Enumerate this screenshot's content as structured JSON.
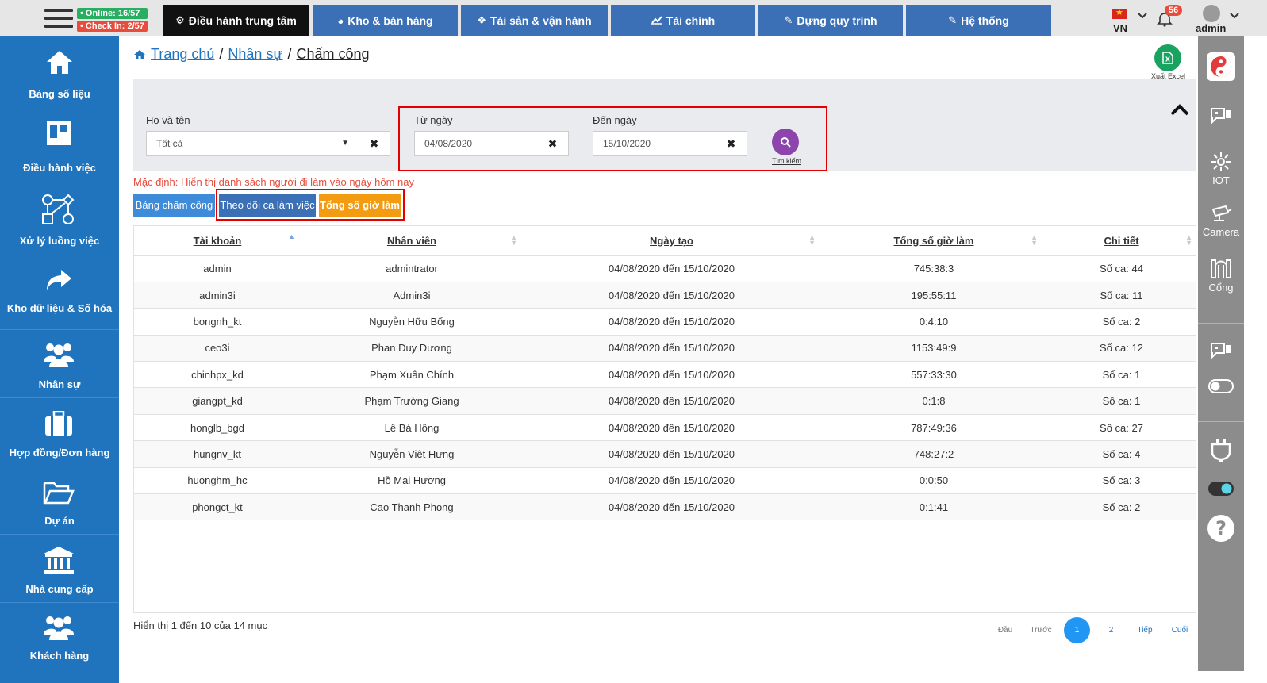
{
  "topbar": {
    "online_badge": "• Online: 16/57",
    "checkin_badge": "• Check In: 2/57",
    "tabs": [
      {
        "label": "Điều hành trung tâm",
        "icon": "gear-icon"
      },
      {
        "label": "Kho & bán hàng",
        "icon": "pie-chart-icon"
      },
      {
        "label": "Tài sản & vận hành",
        "icon": "cubes-icon"
      },
      {
        "label": "Tài chính",
        "icon": "line-chart-icon"
      },
      {
        "label": "Dựng quy trình",
        "icon": "edit-icon"
      },
      {
        "label": "Hệ thống",
        "icon": "edit-icon"
      }
    ],
    "language": "VN",
    "notification_count": "56",
    "username": "admin"
  },
  "sidebar": {
    "items": [
      {
        "label": "Bảng số liệu",
        "icon": "home-icon"
      },
      {
        "label": "Điều hành việc",
        "icon": "columns-icon"
      },
      {
        "label": "Xử lý luồng việc",
        "icon": "workflow-icon"
      },
      {
        "label": "Kho dữ liệu & Số hóa",
        "icon": "share-arrow-icon"
      },
      {
        "label": "Nhân sự",
        "icon": "users-icon"
      },
      {
        "label": "Hợp đồng/Đơn hàng",
        "icon": "briefcase-icon"
      },
      {
        "label": "Dự án",
        "icon": "folder-open-icon"
      },
      {
        "label": "Nhà cung cấp",
        "icon": "bank-icon"
      },
      {
        "label": "Khách hàng",
        "icon": "users-icon"
      }
    ]
  },
  "right_sidebar": {
    "items": [
      {
        "label": "",
        "icon": "brand-logo-icon"
      },
      {
        "label": "",
        "icon": "video-chat-icon"
      },
      {
        "label": "IOT",
        "icon": "iot-icon"
      },
      {
        "label": "Camera",
        "icon": "camera-icon"
      },
      {
        "label": "Cổng",
        "icon": "gate-icon"
      },
      {
        "label": "",
        "icon": "video-chat-icon"
      },
      {
        "label": "",
        "icon": "toggle-off-icon"
      },
      {
        "label": "",
        "icon": "plug-icon"
      },
      {
        "label": "",
        "icon": "toggle-on-icon"
      },
      {
        "label": "",
        "icon": "help-icon"
      }
    ]
  },
  "breadcrumb": {
    "home": "Trang chủ",
    "section": "Nhân sự",
    "current": "Chấm công",
    "separator": "/"
  },
  "export": {
    "label": "Xuất Excel"
  },
  "filters": {
    "name_label": "Họ và tên",
    "name_value": "Tất cả",
    "from_label": "Từ ngày",
    "from_value": "04/08/2020",
    "to_label": "Đến ngày",
    "to_value": "15/10/2020",
    "search_label": "Tìm kiếm"
  },
  "default_note": "Mặc định: Hiển thị danh sách người đi làm vào ngày hôm nay",
  "subtabs": [
    {
      "label": "Bảng chấm công"
    },
    {
      "label": "Theo dõi ca làm việc"
    },
    {
      "label": "Tổng số giờ làm"
    }
  ],
  "table": {
    "columns": [
      "Tài khoản",
      "Nhân viên",
      "Ngày tạo",
      "Tổng số giờ làm",
      "Chi tiết"
    ],
    "rows": [
      [
        "admin",
        "admintrator",
        "04/08/2020 đến 15/10/2020",
        "745:38:3",
        "Số ca: 44"
      ],
      [
        "admin3i",
        "Admin3i",
        "04/08/2020 đến 15/10/2020",
        "195:55:11",
        "Số ca: 11"
      ],
      [
        "bongnh_kt",
        "Nguyễn Hữu Bổng",
        "04/08/2020 đến 15/10/2020",
        "0:4:10",
        "Số ca: 2"
      ],
      [
        "ceo3i",
        "Phan Duy Dương",
        "04/08/2020 đến 15/10/2020",
        "1153:49:9",
        "Số ca: 12"
      ],
      [
        "chinhpx_kd",
        "Phạm Xuân Chính",
        "04/08/2020 đến 15/10/2020",
        "557:33:30",
        "Số ca: 1"
      ],
      [
        "giangpt_kd",
        "Phạm Trường Giang",
        "04/08/2020 đến 15/10/2020",
        "0:1:8",
        "Số ca: 1"
      ],
      [
        "honglb_bgd",
        "Lê Bá Hồng",
        "04/08/2020 đến 15/10/2020",
        "787:49:36",
        "Số ca: 27"
      ],
      [
        "hungnv_kt",
        "Nguyễn Việt Hưng",
        "04/08/2020 đến 15/10/2020",
        "748:27:2",
        "Số ca: 4"
      ],
      [
        "huonghm_hc",
        "Hồ Mai Hương",
        "04/08/2020 đến 15/10/2020",
        "0:0:50",
        "Số ca: 3"
      ],
      [
        "phongct_kt",
        "Cao Thanh Phong",
        "04/08/2020 đến 15/10/2020",
        "0:1:41",
        "Số ca: 2"
      ]
    ],
    "info": "Hiển thị 1 đến 10 của 14 mục"
  },
  "pagination": {
    "first": "Đầu",
    "prev": "Trước",
    "pages": [
      "1",
      "2"
    ],
    "current_page": "1",
    "next": "Tiếp",
    "last": "Cuối"
  },
  "colors": {
    "sidebar_bg": "#1f74bd",
    "tab_bg": "#3b6fb6",
    "tab_active_bg": "#111111",
    "highlight_box": "#e20000",
    "orange_tab": "#f39c12",
    "search_button": "#8e44ad",
    "excel_button": "#1aa260",
    "page_active": "#2196f3"
  }
}
